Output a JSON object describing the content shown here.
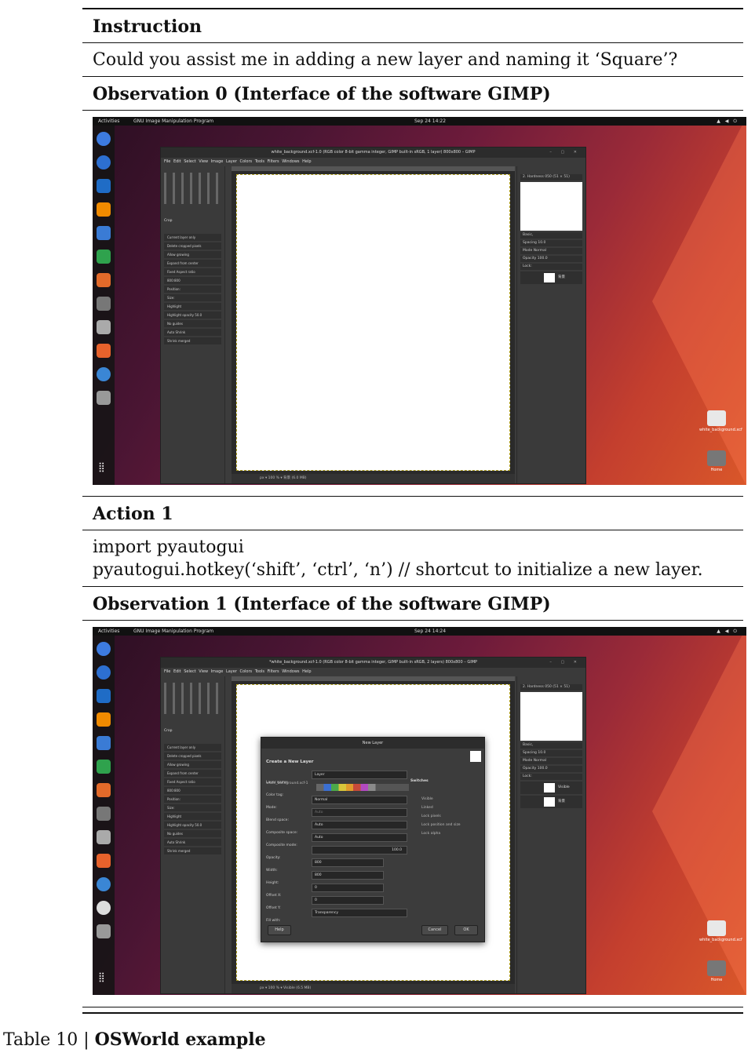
{
  "table": {
    "instruction_header": "Instruction",
    "instruction_text": "Could you assist me in adding a new layer and naming it ‘Square’?",
    "obs0_header": "Observation 0 (Interface of the software GIMP)",
    "action1_header": "Action 1",
    "action1_line1": "import pyautogui",
    "action1_line2": "pyautogui.hotkey(‘shift’, ‘ctrl’, ‘n’) // shortcut to initialize a new layer.",
    "obs1_header": "Observation 1 (Interface of the software GIMP)"
  },
  "screenshot0": {
    "topbar": {
      "activities": "Activities",
      "app": "GNU Image Manipulation Program",
      "clock": "Sep 24  14:22"
    },
    "window_title": "white_background.xcf-1.0 (RGB color 8-bit gamma integer, GIMP built-in sRGB, 1 layer) 800x800 – GIMP",
    "menu": "File  Edit  Select  View  Image  Layer  Colors  Tools  Filters  Windows  Help",
    "status": "px  ▾  100 %  ▾   背景 (6.0 MB)",
    "tool_options_label": "Crop",
    "options": [
      "Current layer only",
      "Delete cropped pixels",
      "Allow growing",
      "Expand from center",
      "Fixed   Aspect ratio",
      "800:800",
      "Position:",
      "Size:",
      "Highlight",
      "Highlight opacity   50.0",
      "No guides",
      "Auto Shrink",
      "Shrink merged"
    ],
    "brushes_label": "2. Hardness 050 (51 × 51)",
    "dock_rows": [
      "Basic,",
      "Spacing   10.0",
      "Mode   Normal",
      "Opacity   100.0",
      "Lock:"
    ],
    "layers": [
      {
        "name": "背景"
      }
    ],
    "desktop": {
      "file_label": "white_background.xcf",
      "home_label": "Home"
    }
  },
  "screenshot1": {
    "topbar": {
      "activities": "Activities",
      "app": "GNU Image Manipulation Program",
      "clock": "Sep 24  14:24"
    },
    "window_title": "*white_background.xcf-1.0 (RGB color 8-bit gamma integer, GIMP built-in sRGB, 2 layers) 800x800 – GIMP",
    "menu": "File  Edit  Select  View  Image  Layer  Colors  Tools  Filters  Windows  Help",
    "status": "px  ▾  100 %  ▾  Visible (6.5 MB)",
    "tool_options_label": "Crop",
    "options": [
      "Current layer only",
      "Delete cropped pixels",
      "Allow growing",
      "Expand from center",
      "Fixed   Aspect ratio",
      "800:800",
      "Position:",
      "Size:",
      "Highlight",
      "Highlight opacity   50.0",
      "No guides",
      "Auto Shrink",
      "Shrink merged"
    ],
    "brushes_label": "2. Hardness 050 (51 × 51)",
    "dock_rows": [
      "Basic,",
      "Spacing   10.0",
      "Mode   Normal",
      "Opacity   100.0",
      "Lock:"
    ],
    "layers": [
      {
        "name": "Visible"
      },
      {
        "name": "背景"
      }
    ],
    "desktop": {
      "file_label": "white_background.xcf",
      "home_label": "Home"
    },
    "dialog": {
      "title": "New Layer",
      "header": "Create a New Layer",
      "subheader": "white_background.xcf-1",
      "fields": [
        {
          "label": "Layer name:",
          "value": "Layer"
        },
        {
          "label": "Color tag:",
          "value": ""
        },
        {
          "label": "Mode:",
          "value": "Normal"
        },
        {
          "label": "Blend space:",
          "value": "Auto"
        },
        {
          "label": "Composite space:",
          "value": "Auto"
        },
        {
          "label": "Composite mode:",
          "value": "Auto"
        },
        {
          "label": "Opacity:",
          "value": "100.0"
        },
        {
          "label": "Width:",
          "value": "800"
        },
        {
          "label": "Height:",
          "value": "800"
        },
        {
          "label": "Offset X:",
          "value": "0"
        },
        {
          "label": "Offset Y:",
          "value": "0"
        },
        {
          "label": "Fill with:",
          "value": "Transparency"
        }
      ],
      "switches_title": "Switches",
      "switches": [
        "Visible",
        "Linked",
        "Lock pixels",
        "Lock position and size",
        "Lock alpha"
      ],
      "help": "Help",
      "cancel": "Cancel",
      "ok": "OK"
    }
  },
  "caption": {
    "prefix": "Table 10 | ",
    "title": "OSWorld example"
  }
}
